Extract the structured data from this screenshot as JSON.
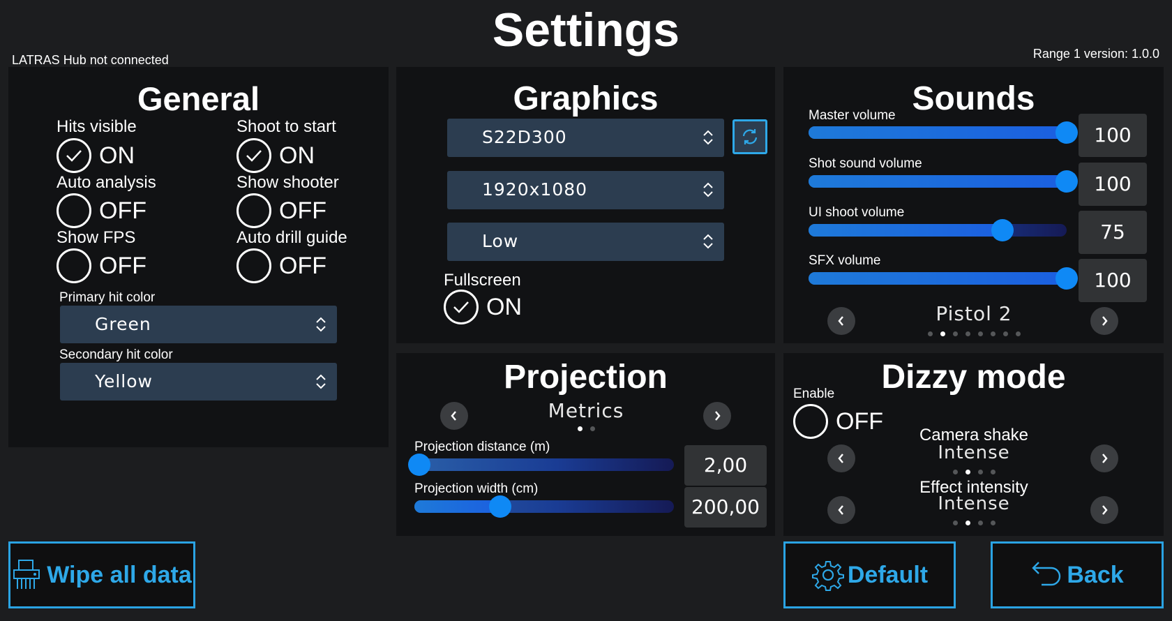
{
  "header": {
    "title": "Settings",
    "hub_status": "LATRAS Hub not connected",
    "version": "Range 1 version: 1.0.0"
  },
  "general": {
    "title": "General",
    "toggles": [
      {
        "label": "Hits visible",
        "state": "ON",
        "checked": true
      },
      {
        "label": "Shoot to start",
        "state": "ON",
        "checked": true
      },
      {
        "label": "Auto analysis",
        "state": "OFF",
        "checked": false
      },
      {
        "label": "Show shooter",
        "state": "OFF",
        "checked": false
      },
      {
        "label": "Show FPS",
        "state": "OFF",
        "checked": false
      },
      {
        "label": "Auto drill guide",
        "state": "OFF",
        "checked": false
      }
    ],
    "primary_hit_color": {
      "label": "Primary hit color",
      "value": "Green"
    },
    "secondary_hit_color": {
      "label": "Secondary hit color",
      "value": "Yellow"
    }
  },
  "graphics": {
    "title": "Graphics",
    "display": "S22D300",
    "resolution": "1920x1080",
    "quality": "Low",
    "fullscreen": {
      "label": "Fullscreen",
      "state": "ON",
      "checked": true
    }
  },
  "sounds": {
    "title": "Sounds",
    "sliders": [
      {
        "label": "Master volume",
        "value": "100",
        "level": 1.0
      },
      {
        "label": "Shot sound volume",
        "value": "100",
        "level": 1.0
      },
      {
        "label": "UI shoot volume",
        "value": "75",
        "level": 0.75
      },
      {
        "label": "SFX volume",
        "value": "100",
        "level": 1.0
      }
    ],
    "shot_sound": {
      "value": "Pistol 2",
      "dot_count": 8,
      "active_index": 1
    }
  },
  "projection": {
    "title": "Projection",
    "unit": {
      "value": "Metrics",
      "dot_count": 2,
      "active_index": 0
    },
    "distance": {
      "label": "Projection distance (m)",
      "value": "2,00",
      "level": 0.02
    },
    "width": {
      "label": "Projection width (cm)",
      "value": "200,00",
      "level": 0.33
    }
  },
  "dizzy": {
    "title": "Dizzy mode",
    "enable": {
      "label": "Enable",
      "state": "OFF",
      "checked": false
    },
    "camera_shake": {
      "label": "Camera shake",
      "value": "Intense",
      "dot_count": 4,
      "active_index": 1
    },
    "effect_intensity": {
      "label": "Effect intensity",
      "value": "Intense",
      "dot_count": 4,
      "active_index": 1
    }
  },
  "buttons": {
    "wipe": "Wipe all data",
    "default": "Default",
    "back": "Back"
  },
  "colors": {
    "accent": "#2ea8e8",
    "panel": "#111214",
    "select_bg": "#2c3d50",
    "slider_thumb": "#0f89f5"
  }
}
